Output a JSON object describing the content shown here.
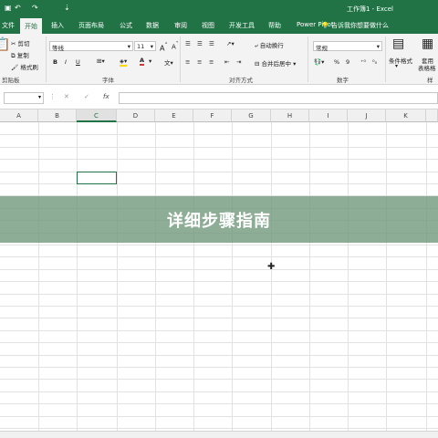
{
  "titlebar": {
    "title": "工作簿1 - Excel",
    "save_icon": "save-icon",
    "undo_icon": "undo-icon",
    "redo_icon": "redo-icon"
  },
  "tabs": [
    {
      "label": "文件",
      "active": false
    },
    {
      "label": "开始",
      "active": true
    },
    {
      "label": "插入",
      "active": false
    },
    {
      "label": "页面布局",
      "active": false
    },
    {
      "label": "公式",
      "active": false
    },
    {
      "label": "数据",
      "active": false
    },
    {
      "label": "审阅",
      "active": false
    },
    {
      "label": "视图",
      "active": false
    },
    {
      "label": "开发工具",
      "active": false
    },
    {
      "label": "帮助",
      "active": false
    },
    {
      "label": "Power Pivot",
      "active": false
    }
  ],
  "tell_me": "告诉我你想要做什么",
  "ribbon": {
    "clipboard": {
      "cut": "剪切",
      "copy": "复制",
      "format_painter": "格式刷",
      "group": "剪贴板"
    },
    "font": {
      "name": "等线",
      "size": "11",
      "bold": "B",
      "italic": "I",
      "underline": "U",
      "group": "字体"
    },
    "alignment": {
      "wrap": "自动换行",
      "merge": "合并后居中",
      "group": "对齐方式"
    },
    "number": {
      "format": "常规",
      "percent": "%",
      "comma": "9",
      "group": "数字"
    },
    "styles": {
      "conditional": "条件格式",
      "table_line1": "套用",
      "table_line2": "表格格",
      "group": "样"
    }
  },
  "formula_bar": {
    "cancel": "✕",
    "enter": "✓",
    "fx": "fx",
    "value": ""
  },
  "columns": [
    "A",
    "B",
    "C",
    "D",
    "E",
    "F",
    "G",
    "H",
    "I",
    "J",
    "K"
  ],
  "banner_text": "详细步骤指南",
  "accent": "#217346"
}
